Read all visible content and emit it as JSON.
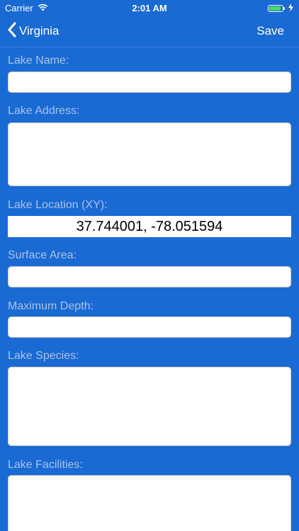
{
  "status_bar": {
    "carrier": "Carrier",
    "time": "2:01 AM",
    "battery_level": 0.9,
    "battery_color": "#4cd964"
  },
  "nav": {
    "back_label": "Virginia",
    "back_icon": "chevron-left-icon",
    "save_label": "Save"
  },
  "form": {
    "lake_name": {
      "label": "Lake Name:",
      "value": ""
    },
    "lake_address": {
      "label": "Lake Address:",
      "value": ""
    },
    "lake_location": {
      "label": "Lake Location (XY):",
      "value": "37.744001, -78.051594"
    },
    "surface_area": {
      "label": "Surface Area:",
      "value": ""
    },
    "maximum_depth": {
      "label": "Maximum Depth:",
      "value": ""
    },
    "lake_species": {
      "label": "Lake Species:",
      "value": ""
    },
    "lake_facilities": {
      "label": "Lake Facilities:",
      "value": ""
    }
  },
  "colors": {
    "background": "#1a6ad4",
    "label": "#a9c2e6",
    "field": "#ffffff"
  }
}
